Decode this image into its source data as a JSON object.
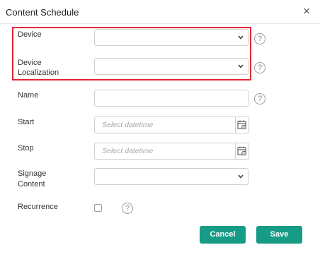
{
  "dialog": {
    "title": "Content Schedule",
    "close_icon": "close-icon",
    "close_glyph": "×"
  },
  "fields": {
    "device": {
      "label": "Device",
      "value": ""
    },
    "device_localization": {
      "label_line1": "Device",
      "label_line2": "Localization",
      "value": ""
    },
    "name": {
      "label": "Name",
      "value": ""
    },
    "start": {
      "label": "Start",
      "placeholder": "Select datetime"
    },
    "stop": {
      "label": "Stop",
      "placeholder": "Select datetime"
    },
    "signage_content": {
      "label_line1": "Signage",
      "label_line2": "Content",
      "value": ""
    },
    "recurrence": {
      "label": "Recurrence",
      "checked": false
    }
  },
  "help_glyph": "?",
  "buttons": {
    "cancel": "Cancel",
    "save": "Save"
  },
  "colors": {
    "primary_button": "#169b86",
    "highlight_border": "#e32636"
  }
}
